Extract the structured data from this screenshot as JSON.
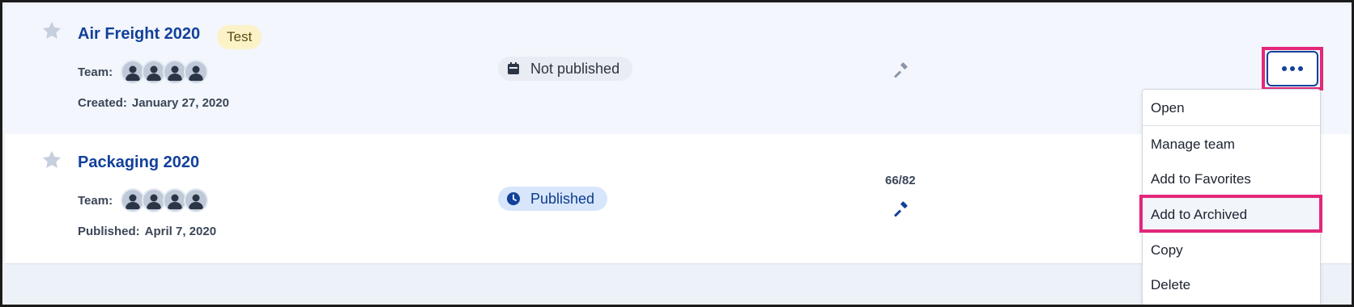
{
  "projects": [
    {
      "title": "Air Freight 2020",
      "tag": "Test",
      "team_label": "Team:",
      "date_label": "Created:",
      "date_value": "January 27, 2020",
      "status": "Not published"
    },
    {
      "title": "Packaging 2020",
      "team_label": "Team:",
      "date_label": "Published:",
      "date_value": "April 7, 2020",
      "status": "Published",
      "count": "66/82"
    }
  ],
  "menu": {
    "items": [
      "Open",
      "Manage team",
      "Add to Favorites",
      "Add to Archived",
      "Copy",
      "Delete"
    ]
  },
  "colors": {
    "accent": "#12409a",
    "highlight": "#e3277a",
    "tag_bg": "#fbf2c8",
    "published_bg": "#d8e6fb"
  },
  "icons": {
    "favorite": "star-icon",
    "team": "person-icon",
    "not_published": "calendar-icon",
    "published": "clock-icon",
    "gavel": "gavel-icon",
    "more": "more-horizontal-icon"
  }
}
